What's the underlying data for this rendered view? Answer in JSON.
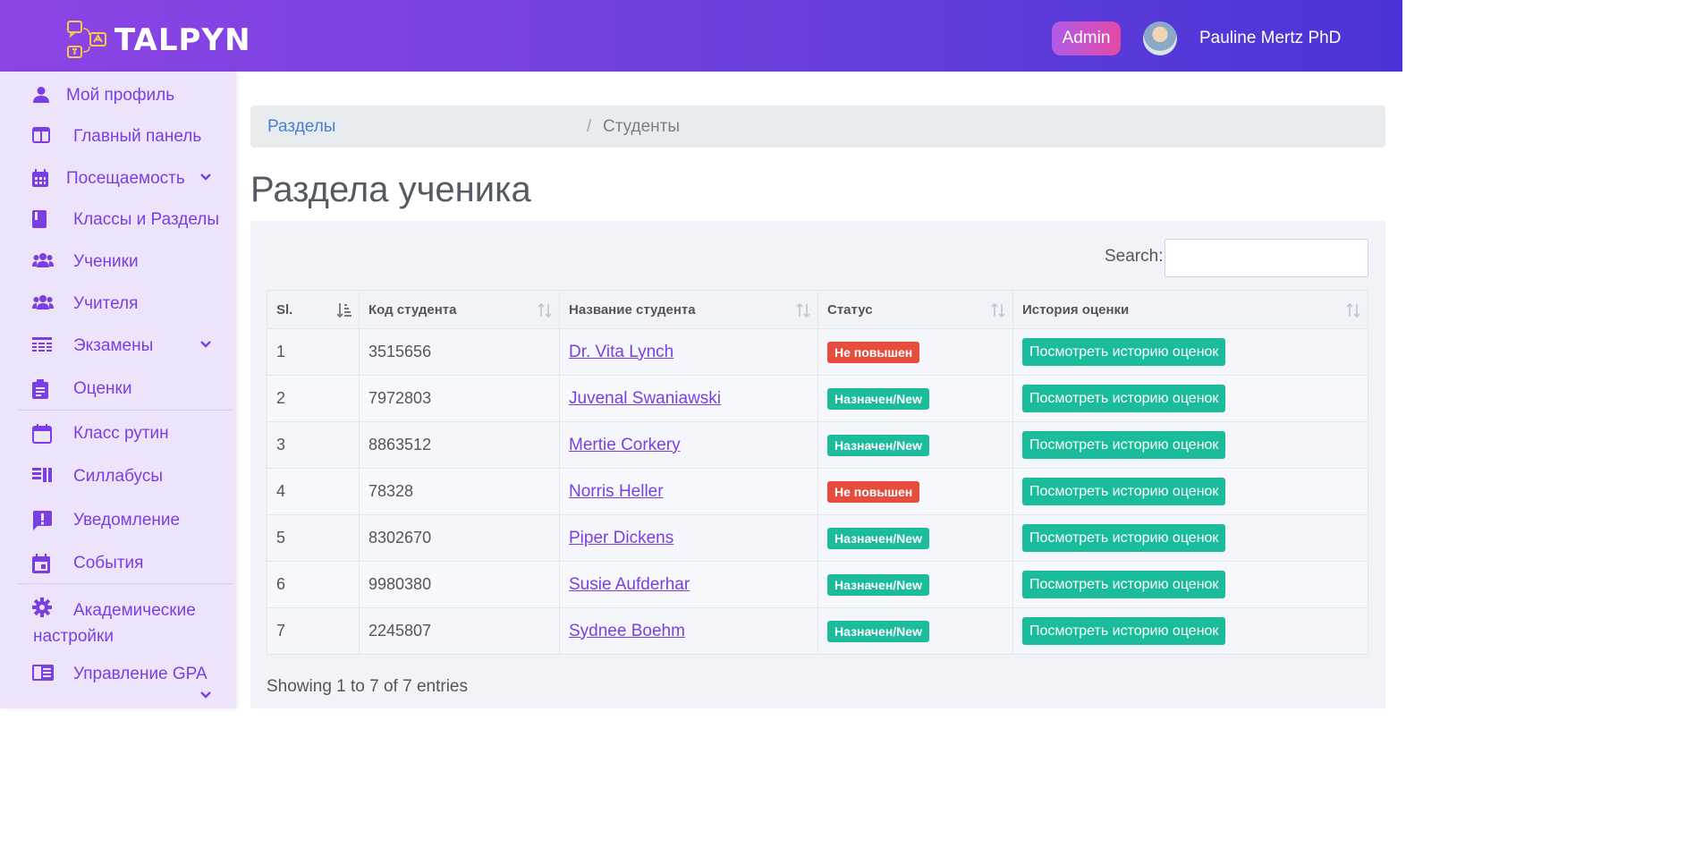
{
  "app": {
    "name": "TALPYN",
    "brand_color": "#7a3fe4",
    "header_gradient": [
      "#8e44e6",
      "#4a33d6"
    ]
  },
  "header": {
    "role_badge": "Admin",
    "user_name": "Pauline Mertz PhD"
  },
  "sidebar": {
    "items": [
      {
        "label": "Мой профиль",
        "icon": "user-icon"
      },
      {
        "label": "Главный панель",
        "icon": "dashboard-icon"
      },
      {
        "label": "Посещаемость",
        "icon": "calendar-grid-icon",
        "has_submenu": true
      },
      {
        "label": "Классы и Разделы",
        "icon": "book-icon"
      },
      {
        "label": "Ученики",
        "icon": "users-icon"
      },
      {
        "label": "Учителя",
        "icon": "users-icon"
      },
      {
        "label": "Экзамены",
        "icon": "table-icon",
        "has_submenu": true
      },
      {
        "label": "Оценки",
        "icon": "clipboard-icon"
      },
      {
        "label": "Класс рутин",
        "icon": "calendar-icon"
      },
      {
        "label": "Силлабусы",
        "icon": "syllabus-icon"
      },
      {
        "label": "Уведомление",
        "icon": "alert-message-icon"
      },
      {
        "label": "События",
        "icon": "event-icon"
      },
      {
        "label": "Академические настройки",
        "icon": "gear-icon"
      },
      {
        "label": "Управление GPA",
        "icon": "gpa-card-icon",
        "has_submenu": true
      }
    ]
  },
  "breadcrumb": {
    "parent": "Разделы",
    "separator": "/",
    "current": "Студенты"
  },
  "page": {
    "title": "Раздела ученика"
  },
  "search": {
    "label": "Search:",
    "value": "",
    "placeholder": ""
  },
  "table": {
    "columns": [
      "Sl.",
      "Код студента",
      "Название студента",
      "Статус",
      "История оценки"
    ],
    "rows": [
      {
        "sl": "1",
        "code": "3515656",
        "name": "Dr. Vita Lynch",
        "status": "Не повышен",
        "status_color": "#e74c3c",
        "action": "Посмотреть историю оценок"
      },
      {
        "sl": "2",
        "code": "7972803",
        "name": "Juvenal Swaniawski",
        "status": "Назначен/New",
        "status_color": "#1abc9c",
        "action": "Посмотреть историю оценок"
      },
      {
        "sl": "3",
        "code": "8863512",
        "name": "Mertie Corkery",
        "status": "Назначен/New",
        "status_color": "#1abc9c",
        "action": "Посмотреть историю оценок"
      },
      {
        "sl": "4",
        "code": "78328",
        "name": "Norris Heller",
        "status": "Не повышен",
        "status_color": "#e74c3c",
        "action": "Посмотреть историю оценок"
      },
      {
        "sl": "5",
        "code": "8302670",
        "name": "Piper Dickens",
        "status": "Назначен/New",
        "status_color": "#1abc9c",
        "action": "Посмотреть историю оценок"
      },
      {
        "sl": "6",
        "code": "9980380",
        "name": "Susie Aufderhar",
        "status": "Назначен/New",
        "status_color": "#1abc9c",
        "action": "Посмотреть историю оценок"
      },
      {
        "sl": "7",
        "code": "2245807",
        "name": "Sydnee Boehm",
        "status": "Назначен/New",
        "status_color": "#1abc9c",
        "action": "Посмотреть историю оценок"
      }
    ]
  },
  "footer": {
    "showing": "Showing 1 to 7 of 7 entries"
  }
}
